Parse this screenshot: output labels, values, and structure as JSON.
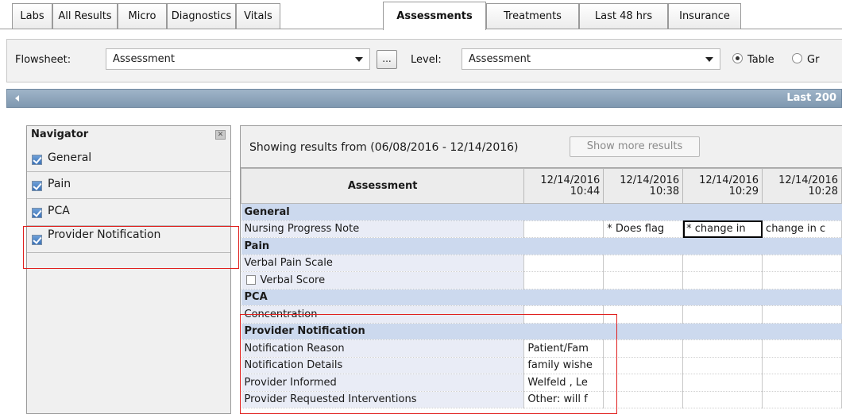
{
  "tabs": [
    {
      "label": "Labs",
      "active": false
    },
    {
      "label": "All Results",
      "active": false
    },
    {
      "label": "Micro",
      "active": false
    },
    {
      "label": "Diagnostics",
      "active": false
    },
    {
      "label": "Vitals",
      "active": false
    },
    {
      "label": "Assessments",
      "active": true
    },
    {
      "label": "Treatments",
      "active": false
    },
    {
      "label": "Last 48 hrs",
      "active": false
    },
    {
      "label": "Insurance",
      "active": false
    }
  ],
  "toolbar": {
    "flowsheet_label": "Flowsheet:",
    "flowsheet_value": "Assessment",
    "ellipsis_label": "...",
    "level_label": "Level:",
    "level_value": "Assessment",
    "view_options": [
      {
        "label": "Table",
        "selected": true
      },
      {
        "label": "Gr",
        "selected": false
      }
    ]
  },
  "rangebar": {
    "label": "Last 200"
  },
  "navigator": {
    "title": "Navigator",
    "close_glyph": "✕",
    "items": [
      {
        "label": "General",
        "checked": true
      },
      {
        "label": "Pain",
        "checked": true
      },
      {
        "label": "PCA",
        "checked": true
      },
      {
        "label": "Provider Notification",
        "checked": true
      }
    ]
  },
  "results": {
    "showing_text": "Showing results from (06/08/2016 - 12/14/2016)",
    "show_more_label": "Show more results",
    "assessment_header": "Assessment",
    "columns": [
      {
        "date": "12/14/2016",
        "time": "10:44"
      },
      {
        "date": "12/14/2016",
        "time": "10:38"
      },
      {
        "date": "12/14/2016",
        "time": "10:29"
      },
      {
        "date": "12/14/2016",
        "time": "10:28"
      }
    ],
    "rows": [
      {
        "type": "section",
        "label": "General"
      },
      {
        "type": "item",
        "label": "Nursing Progress Note",
        "values": [
          "",
          "* Does flag",
          "* change in",
          "change in c"
        ],
        "selected_col": 2
      },
      {
        "type": "section",
        "label": "Pain"
      },
      {
        "type": "item",
        "label": "Verbal Pain Scale",
        "values": [
          "",
          "",
          "",
          ""
        ]
      },
      {
        "type": "checkitem",
        "label": "Verbal Score",
        "values": [
          "",
          "",
          "",
          ""
        ]
      },
      {
        "type": "section",
        "label": "PCA"
      },
      {
        "type": "item",
        "label": "Concentration",
        "values": [
          "",
          "",
          "",
          ""
        ]
      },
      {
        "type": "section",
        "label": "Provider Notification"
      },
      {
        "type": "item",
        "label": "Notification Reason",
        "values": [
          "Patient/Fam",
          "",
          "",
          ""
        ]
      },
      {
        "type": "item",
        "label": "Notification Details",
        "values": [
          "family wishe",
          "",
          "",
          ""
        ]
      },
      {
        "type": "item",
        "label": "Provider Informed",
        "values": [
          "Welfeld , Le",
          "",
          "",
          ""
        ]
      },
      {
        "type": "item",
        "label": "Provider Requested Interventions",
        "values": [
          "Other: will f",
          "",
          "",
          ""
        ]
      }
    ]
  },
  "colors": {
    "section_bg": "#ccd9ee",
    "name_bg": "#e9ecf6",
    "rangebar_bg": "#8aa2ba",
    "annotation_red": "#e0201e"
  }
}
